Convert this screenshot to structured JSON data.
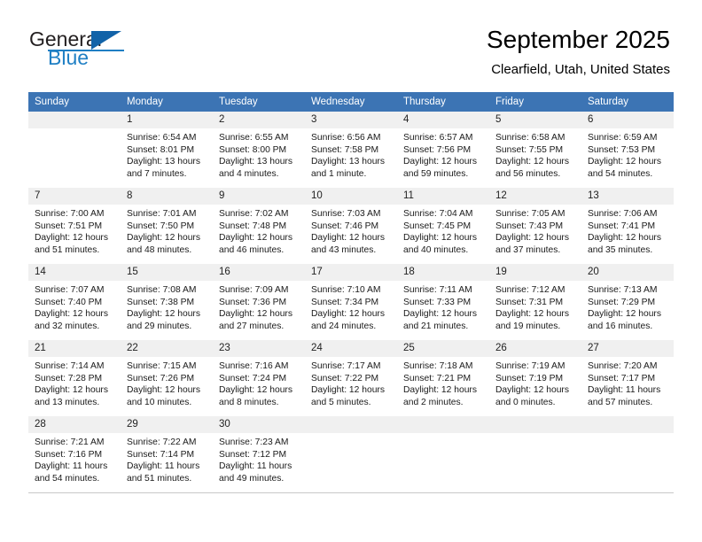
{
  "brand": {
    "name_top": "General",
    "name_bottom": "Blue",
    "accent_color": "#1f7fc4",
    "triangle_color": "#1263a8"
  },
  "header": {
    "title": "September 2025",
    "subtitle": "Clearfield, Utah, United States"
  },
  "theme": {
    "header_bg": "#3c74b4",
    "header_text": "#ffffff",
    "daynum_bg": "#f0f0f0",
    "row_rule": "#3c74b4"
  },
  "columns": [
    "Sunday",
    "Monday",
    "Tuesday",
    "Wednesday",
    "Thursday",
    "Friday",
    "Saturday"
  ],
  "weeks": [
    [
      {
        "day": "",
        "sunrise": "",
        "sunset": "",
        "daylight1": "",
        "daylight2": ""
      },
      {
        "day": "1",
        "sunrise": "Sunrise: 6:54 AM",
        "sunset": "Sunset: 8:01 PM",
        "daylight1": "Daylight: 13 hours",
        "daylight2": "and 7 minutes."
      },
      {
        "day": "2",
        "sunrise": "Sunrise: 6:55 AM",
        "sunset": "Sunset: 8:00 PM",
        "daylight1": "Daylight: 13 hours",
        "daylight2": "and 4 minutes."
      },
      {
        "day": "3",
        "sunrise": "Sunrise: 6:56 AM",
        "sunset": "Sunset: 7:58 PM",
        "daylight1": "Daylight: 13 hours",
        "daylight2": "and 1 minute."
      },
      {
        "day": "4",
        "sunrise": "Sunrise: 6:57 AM",
        "sunset": "Sunset: 7:56 PM",
        "daylight1": "Daylight: 12 hours",
        "daylight2": "and 59 minutes."
      },
      {
        "day": "5",
        "sunrise": "Sunrise: 6:58 AM",
        "sunset": "Sunset: 7:55 PM",
        "daylight1": "Daylight: 12 hours",
        "daylight2": "and 56 minutes."
      },
      {
        "day": "6",
        "sunrise": "Sunrise: 6:59 AM",
        "sunset": "Sunset: 7:53 PM",
        "daylight1": "Daylight: 12 hours",
        "daylight2": "and 54 minutes."
      }
    ],
    [
      {
        "day": "7",
        "sunrise": "Sunrise: 7:00 AM",
        "sunset": "Sunset: 7:51 PM",
        "daylight1": "Daylight: 12 hours",
        "daylight2": "and 51 minutes."
      },
      {
        "day": "8",
        "sunrise": "Sunrise: 7:01 AM",
        "sunset": "Sunset: 7:50 PM",
        "daylight1": "Daylight: 12 hours",
        "daylight2": "and 48 minutes."
      },
      {
        "day": "9",
        "sunrise": "Sunrise: 7:02 AM",
        "sunset": "Sunset: 7:48 PM",
        "daylight1": "Daylight: 12 hours",
        "daylight2": "and 46 minutes."
      },
      {
        "day": "10",
        "sunrise": "Sunrise: 7:03 AM",
        "sunset": "Sunset: 7:46 PM",
        "daylight1": "Daylight: 12 hours",
        "daylight2": "and 43 minutes."
      },
      {
        "day": "11",
        "sunrise": "Sunrise: 7:04 AM",
        "sunset": "Sunset: 7:45 PM",
        "daylight1": "Daylight: 12 hours",
        "daylight2": "and 40 minutes."
      },
      {
        "day": "12",
        "sunrise": "Sunrise: 7:05 AM",
        "sunset": "Sunset: 7:43 PM",
        "daylight1": "Daylight: 12 hours",
        "daylight2": "and 37 minutes."
      },
      {
        "day": "13",
        "sunrise": "Sunrise: 7:06 AM",
        "sunset": "Sunset: 7:41 PM",
        "daylight1": "Daylight: 12 hours",
        "daylight2": "and 35 minutes."
      }
    ],
    [
      {
        "day": "14",
        "sunrise": "Sunrise: 7:07 AM",
        "sunset": "Sunset: 7:40 PM",
        "daylight1": "Daylight: 12 hours",
        "daylight2": "and 32 minutes."
      },
      {
        "day": "15",
        "sunrise": "Sunrise: 7:08 AM",
        "sunset": "Sunset: 7:38 PM",
        "daylight1": "Daylight: 12 hours",
        "daylight2": "and 29 minutes."
      },
      {
        "day": "16",
        "sunrise": "Sunrise: 7:09 AM",
        "sunset": "Sunset: 7:36 PM",
        "daylight1": "Daylight: 12 hours",
        "daylight2": "and 27 minutes."
      },
      {
        "day": "17",
        "sunrise": "Sunrise: 7:10 AM",
        "sunset": "Sunset: 7:34 PM",
        "daylight1": "Daylight: 12 hours",
        "daylight2": "and 24 minutes."
      },
      {
        "day": "18",
        "sunrise": "Sunrise: 7:11 AM",
        "sunset": "Sunset: 7:33 PM",
        "daylight1": "Daylight: 12 hours",
        "daylight2": "and 21 minutes."
      },
      {
        "day": "19",
        "sunrise": "Sunrise: 7:12 AM",
        "sunset": "Sunset: 7:31 PM",
        "daylight1": "Daylight: 12 hours",
        "daylight2": "and 19 minutes."
      },
      {
        "day": "20",
        "sunrise": "Sunrise: 7:13 AM",
        "sunset": "Sunset: 7:29 PM",
        "daylight1": "Daylight: 12 hours",
        "daylight2": "and 16 minutes."
      }
    ],
    [
      {
        "day": "21",
        "sunrise": "Sunrise: 7:14 AM",
        "sunset": "Sunset: 7:28 PM",
        "daylight1": "Daylight: 12 hours",
        "daylight2": "and 13 minutes."
      },
      {
        "day": "22",
        "sunrise": "Sunrise: 7:15 AM",
        "sunset": "Sunset: 7:26 PM",
        "daylight1": "Daylight: 12 hours",
        "daylight2": "and 10 minutes."
      },
      {
        "day": "23",
        "sunrise": "Sunrise: 7:16 AM",
        "sunset": "Sunset: 7:24 PM",
        "daylight1": "Daylight: 12 hours",
        "daylight2": "and 8 minutes."
      },
      {
        "day": "24",
        "sunrise": "Sunrise: 7:17 AM",
        "sunset": "Sunset: 7:22 PM",
        "daylight1": "Daylight: 12 hours",
        "daylight2": "and 5 minutes."
      },
      {
        "day": "25",
        "sunrise": "Sunrise: 7:18 AM",
        "sunset": "Sunset: 7:21 PM",
        "daylight1": "Daylight: 12 hours",
        "daylight2": "and 2 minutes."
      },
      {
        "day": "26",
        "sunrise": "Sunrise: 7:19 AM",
        "sunset": "Sunset: 7:19 PM",
        "daylight1": "Daylight: 12 hours",
        "daylight2": "and 0 minutes."
      },
      {
        "day": "27",
        "sunrise": "Sunrise: 7:20 AM",
        "sunset": "Sunset: 7:17 PM",
        "daylight1": "Daylight: 11 hours",
        "daylight2": "and 57 minutes."
      }
    ],
    [
      {
        "day": "28",
        "sunrise": "Sunrise: 7:21 AM",
        "sunset": "Sunset: 7:16 PM",
        "daylight1": "Daylight: 11 hours",
        "daylight2": "and 54 minutes."
      },
      {
        "day": "29",
        "sunrise": "Sunrise: 7:22 AM",
        "sunset": "Sunset: 7:14 PM",
        "daylight1": "Daylight: 11 hours",
        "daylight2": "and 51 minutes."
      },
      {
        "day": "30",
        "sunrise": "Sunrise: 7:23 AM",
        "sunset": "Sunset: 7:12 PM",
        "daylight1": "Daylight: 11 hours",
        "daylight2": "and 49 minutes."
      },
      {
        "day": "",
        "sunrise": "",
        "sunset": "",
        "daylight1": "",
        "daylight2": ""
      },
      {
        "day": "",
        "sunrise": "",
        "sunset": "",
        "daylight1": "",
        "daylight2": ""
      },
      {
        "day": "",
        "sunrise": "",
        "sunset": "",
        "daylight1": "",
        "daylight2": ""
      },
      {
        "day": "",
        "sunrise": "",
        "sunset": "",
        "daylight1": "",
        "daylight2": ""
      }
    ]
  ]
}
